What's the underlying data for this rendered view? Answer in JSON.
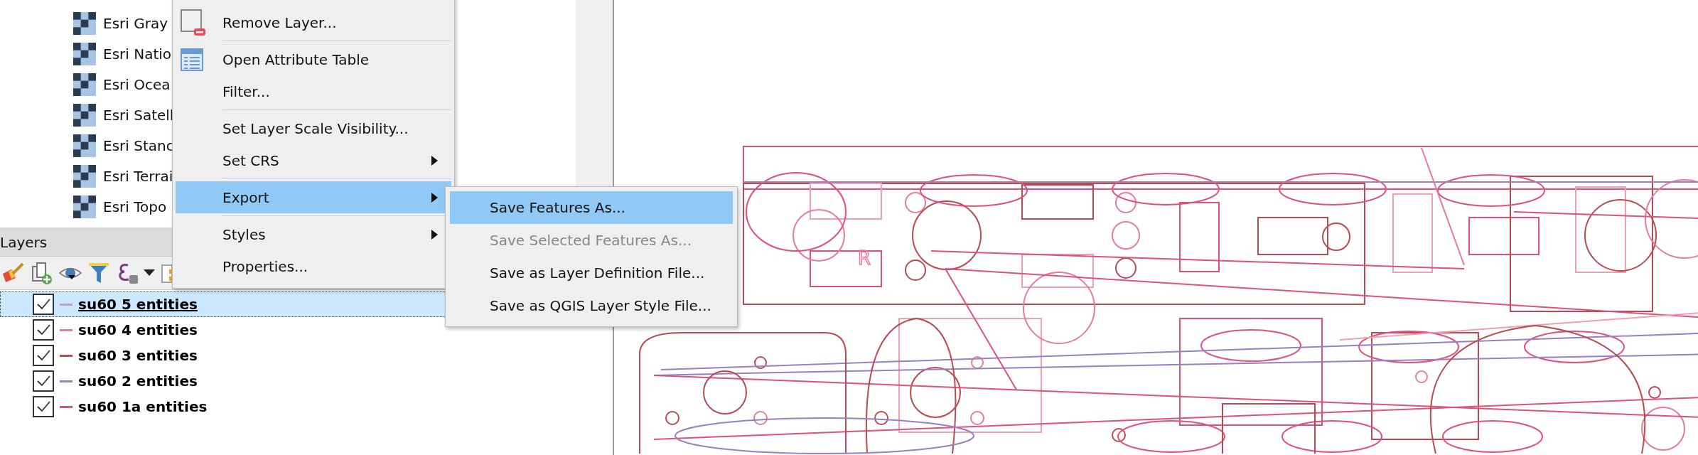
{
  "browser_tree": {
    "items": [
      {
        "label": "Esri Gray"
      },
      {
        "label": "Esri Natio"
      },
      {
        "label": "Esri Ocea"
      },
      {
        "label": "Esri Satell"
      },
      {
        "label": "Esri Stanc"
      },
      {
        "label": "Esri Terrai"
      },
      {
        "label": "Esri Topo"
      }
    ]
  },
  "layers_panel": {
    "title": "Layers",
    "layers": [
      {
        "label": "su60 5 entities",
        "checked": true,
        "selected": true,
        "color": "#b9a3c9"
      },
      {
        "label": "su60 4 entities",
        "checked": true,
        "selected": false,
        "color": "#e87a9a"
      },
      {
        "label": "su60 3 entities",
        "checked": true,
        "selected": false,
        "color": "#b84a50"
      },
      {
        "label": "su60 2 entities",
        "checked": true,
        "selected": false,
        "color": "#9b7fc0"
      },
      {
        "label": "su60 1a entities",
        "checked": true,
        "selected": false,
        "color": "#e0507a"
      }
    ]
  },
  "context_menu": {
    "items": [
      {
        "kind": "item",
        "label": "Remove Layer...",
        "selected": false
      },
      {
        "kind": "separator"
      },
      {
        "kind": "item",
        "label": "Open Attribute Table",
        "selected": false
      },
      {
        "kind": "item",
        "label": "Filter...",
        "selected": false
      },
      {
        "kind": "separator"
      },
      {
        "kind": "item",
        "label": "Set Layer Scale Visibility...",
        "selected": false
      },
      {
        "kind": "submenu",
        "label": "Set CRS",
        "selected": false
      },
      {
        "kind": "separator"
      },
      {
        "kind": "submenu",
        "label": "Export",
        "selected": true
      },
      {
        "kind": "separator"
      },
      {
        "kind": "submenu",
        "label": "Styles",
        "selected": false
      },
      {
        "kind": "item",
        "label": "Properties...",
        "selected": false
      }
    ]
  },
  "export_submenu": {
    "items": [
      {
        "label": "Save Features As...",
        "selected": true,
        "disabled": false
      },
      {
        "label": "Save Selected Features As...",
        "selected": false,
        "disabled": true
      },
      {
        "label": "Save as Layer Definition File...",
        "selected": false,
        "disabled": false
      },
      {
        "label": "Save as QGIS Layer Style File...",
        "selected": false,
        "disabled": false
      }
    ]
  },
  "map": {
    "label": "R"
  }
}
